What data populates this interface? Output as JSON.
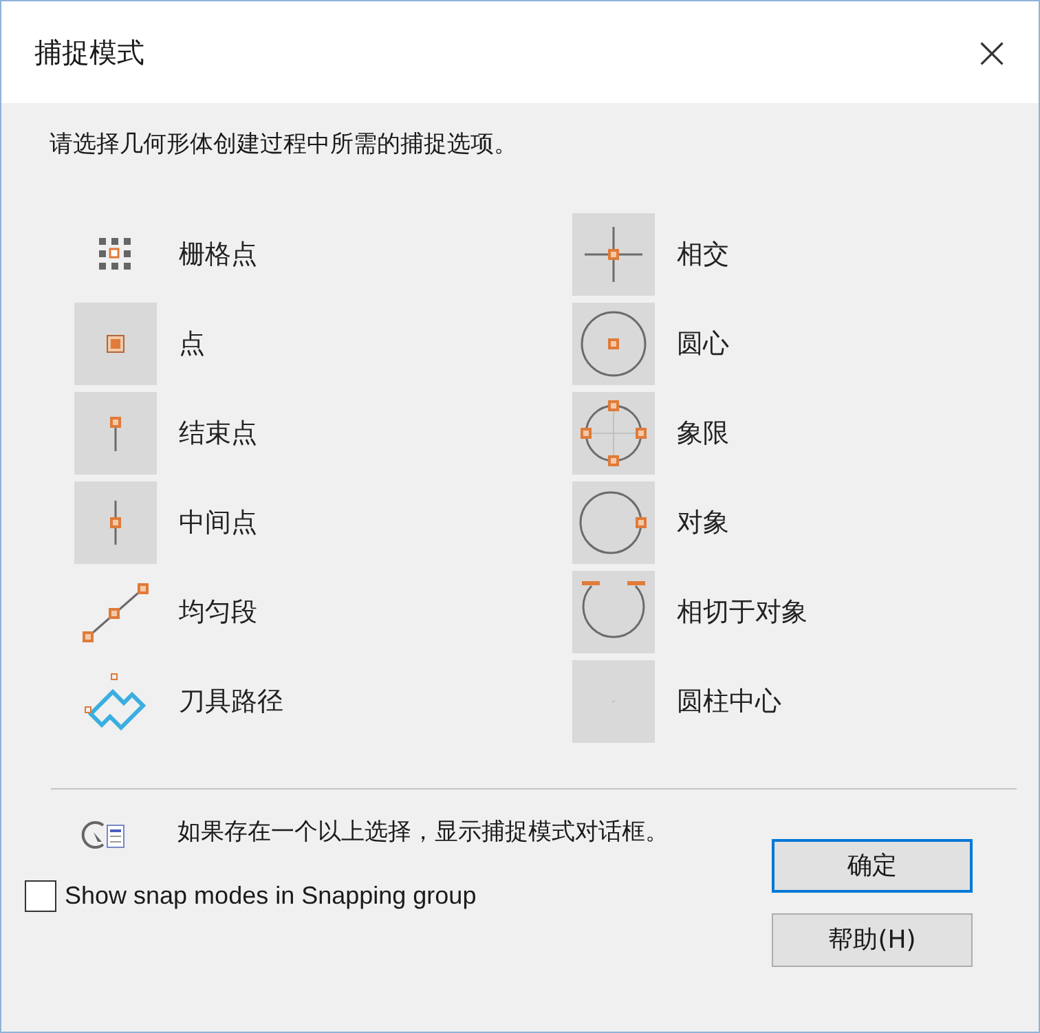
{
  "window": {
    "title": "捕捉模式",
    "close": "×"
  },
  "instruction": "请选择几何形体创建过程中所需的捕捉选项。",
  "snap_columns": [
    [
      {
        "label": "栅格点",
        "kind": "grid",
        "selected": false
      },
      {
        "label": "点",
        "kind": "point",
        "selected": true
      },
      {
        "label": "结束点",
        "kind": "end",
        "selected": true
      },
      {
        "label": "中间点",
        "kind": "mid",
        "selected": true
      },
      {
        "label": "均匀段",
        "kind": "segment",
        "selected": false
      },
      {
        "label": "刀具路径",
        "kind": "toolpath",
        "selected": false
      }
    ],
    [
      {
        "label": "相交",
        "kind": "intersect",
        "selected": true
      },
      {
        "label": "圆心",
        "kind": "center",
        "selected": true
      },
      {
        "label": "象限",
        "kind": "quadrant",
        "selected": true
      },
      {
        "label": "对象",
        "kind": "object",
        "selected": true
      },
      {
        "label": "相切于对象",
        "kind": "tangent",
        "selected": true
      },
      {
        "label": "圆柱中心",
        "kind": "cylinder",
        "selected": true
      }
    ]
  ],
  "note": "如果存在一个以上选择，显示捕捉模式对话框。",
  "show_in_group": {
    "label": "Show snap modes in Snapping group",
    "checked": false
  },
  "buttons": [
    {
      "label": "确定",
      "default": true
    },
    {
      "label": "帮助(H)",
      "default": false
    }
  ]
}
